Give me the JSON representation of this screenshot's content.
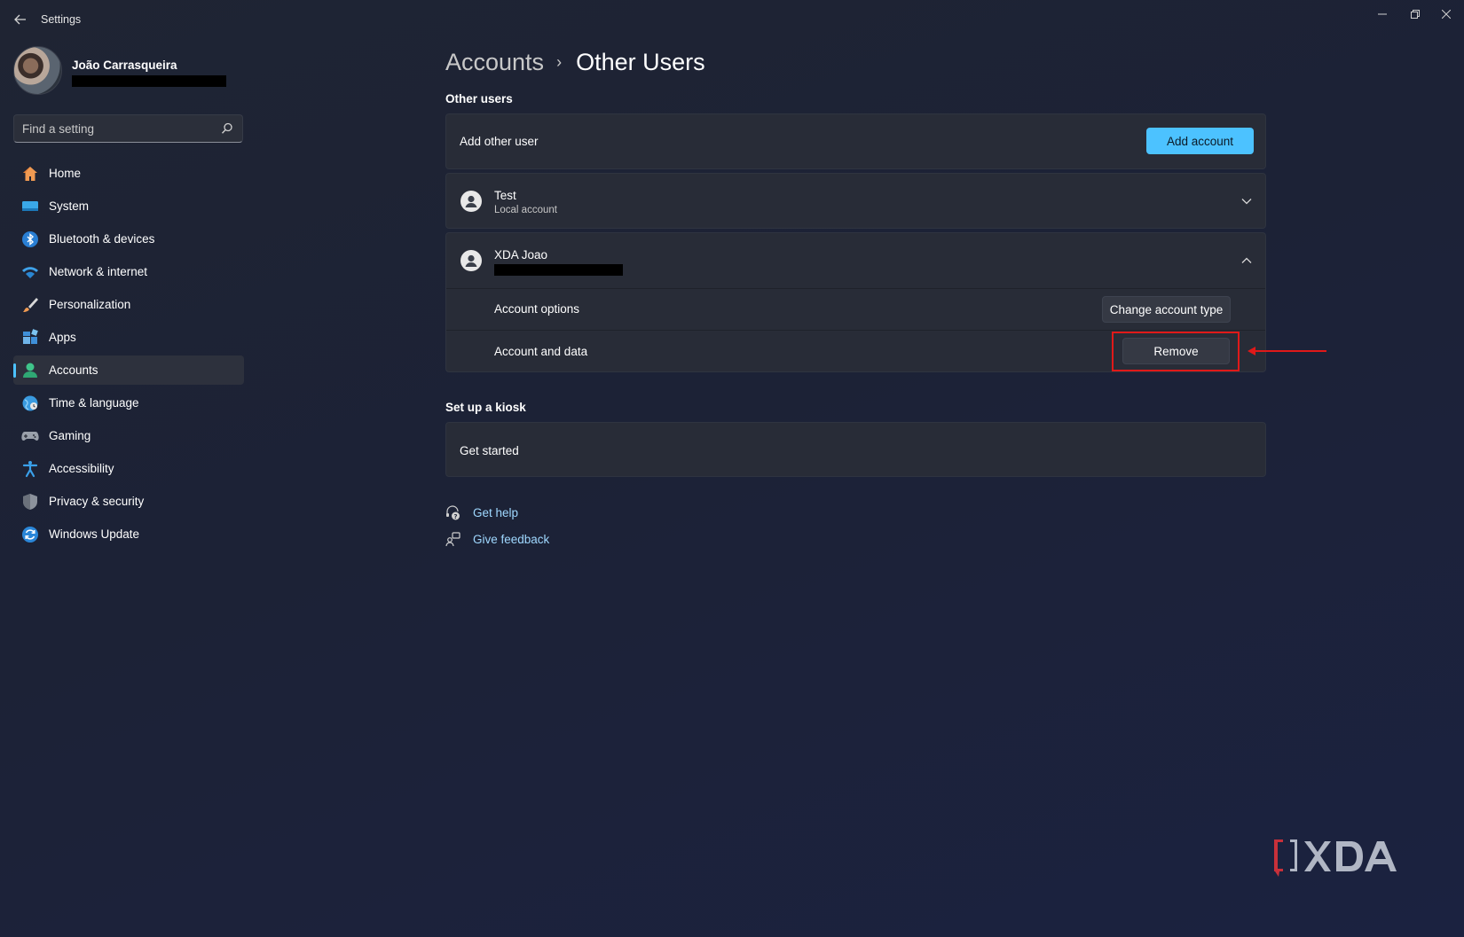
{
  "window": {
    "title": "Settings"
  },
  "profile": {
    "name": "João Carrasqueira"
  },
  "search": {
    "placeholder": "Find a setting"
  },
  "nav": {
    "items": [
      {
        "label": "Home",
        "icon": "home-icon"
      },
      {
        "label": "System",
        "icon": "system-icon"
      },
      {
        "label": "Bluetooth & devices",
        "icon": "bluetooth-icon"
      },
      {
        "label": "Network & internet",
        "icon": "wifi-icon"
      },
      {
        "label": "Personalization",
        "icon": "brush-icon"
      },
      {
        "label": "Apps",
        "icon": "apps-icon"
      },
      {
        "label": "Accounts",
        "icon": "accounts-icon",
        "active": true
      },
      {
        "label": "Time & language",
        "icon": "globe-icon"
      },
      {
        "label": "Gaming",
        "icon": "gamepad-icon"
      },
      {
        "label": "Accessibility",
        "icon": "accessibility-icon"
      },
      {
        "label": "Privacy & security",
        "icon": "shield-icon"
      },
      {
        "label": "Windows Update",
        "icon": "update-icon"
      }
    ]
  },
  "breadcrumb": {
    "parent": "Accounts",
    "separator": "›",
    "current": "Other Users"
  },
  "other_users": {
    "section_title": "Other users",
    "add_label": "Add other user",
    "add_button": "Add account",
    "users": [
      {
        "name": "Test",
        "subtitle": "Local account",
        "expanded": false
      },
      {
        "name": "XDA Joao",
        "expanded": true
      }
    ],
    "options": {
      "account_options_label": "Account options",
      "change_type_button": "Change account type",
      "account_data_label": "Account and data",
      "remove_button": "Remove"
    }
  },
  "kiosk": {
    "section_title": "Set up a kiosk",
    "get_started": "Get started"
  },
  "help": {
    "get_help": "Get help",
    "give_feedback": "Give feedback"
  },
  "watermark": {
    "text": "XDA"
  },
  "colors": {
    "accent": "#4cc2ff",
    "highlight": "#e01919",
    "link": "#9fd8ff"
  }
}
